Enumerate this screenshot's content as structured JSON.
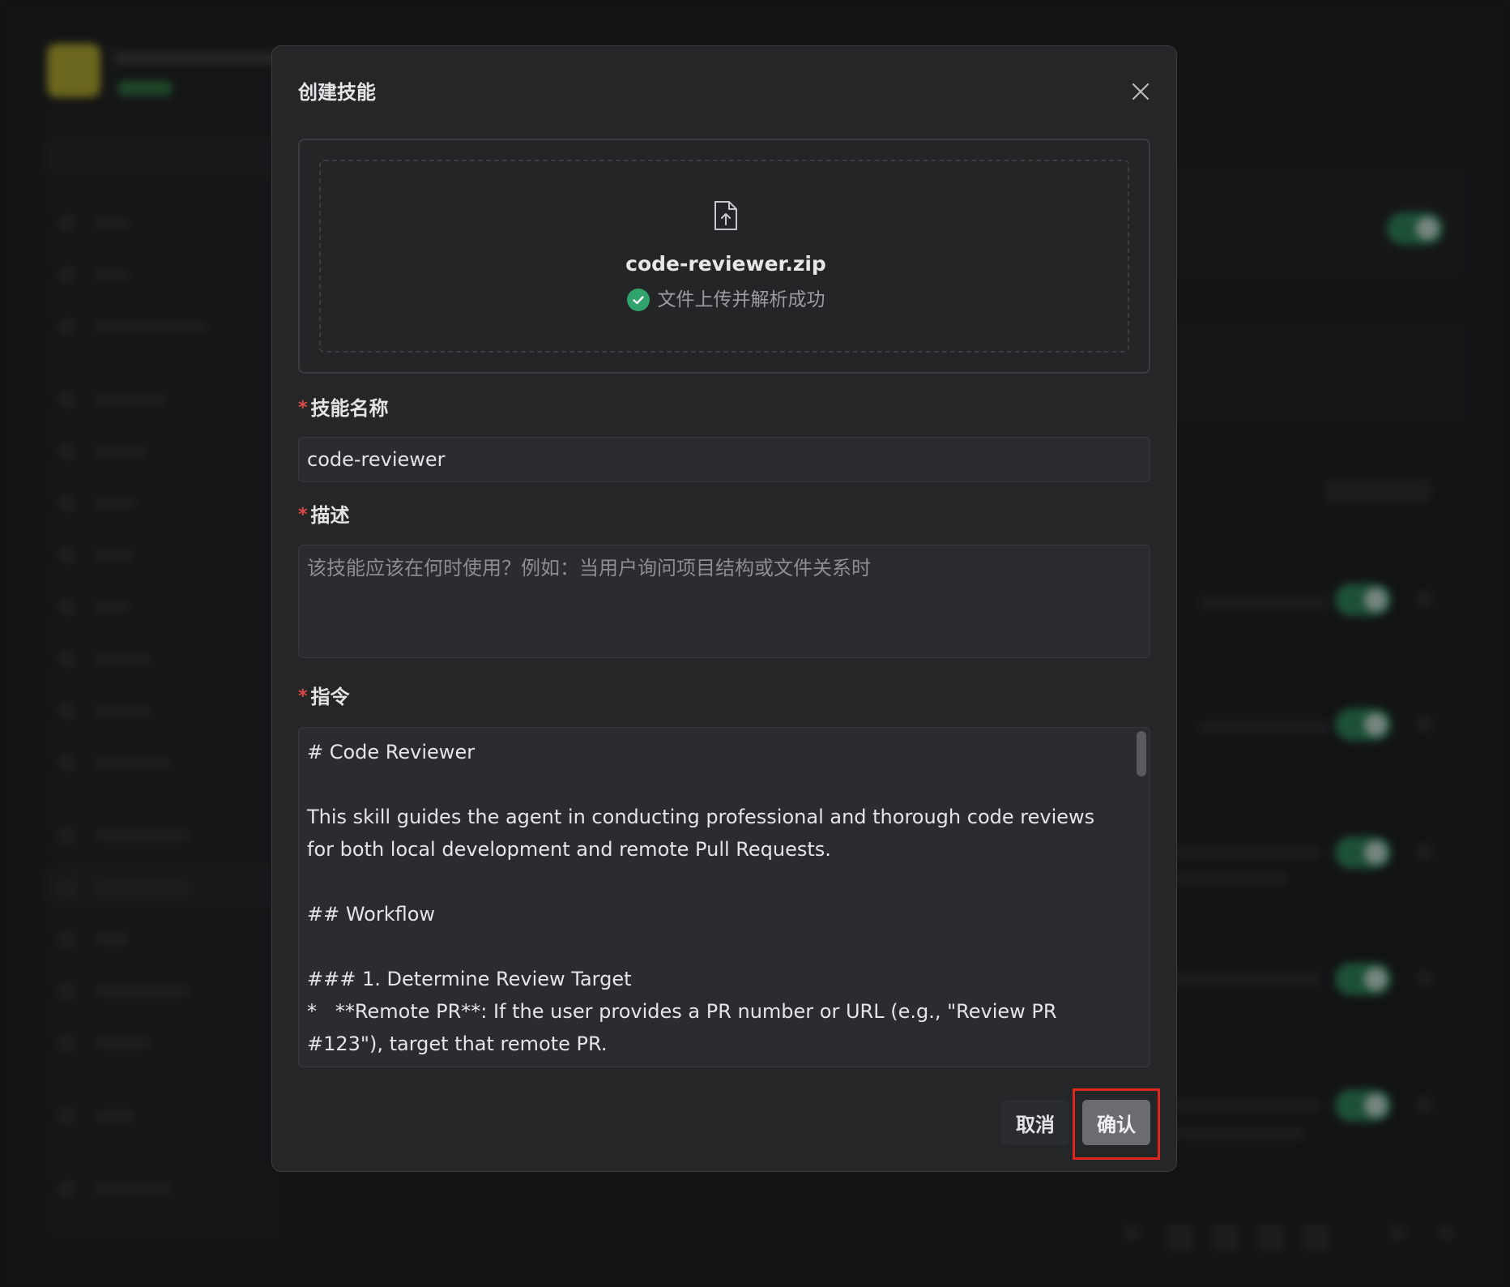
{
  "dialog": {
    "title": "创建技能",
    "upload": {
      "file_name": "code-reviewer.zip",
      "status_text": "文件上传并解析成功"
    },
    "fields": {
      "name_label": "技能名称",
      "name_value": "code-reviewer",
      "description_label": "描述",
      "description_placeholder": "该技能应该在何时使用？例如：当用户询问项目结构或文件关系时",
      "instruction_label": "指令",
      "instruction_value": "# Code Reviewer\n\nThis skill guides the agent in conducting professional and thorough code reviews for both local development and remote Pull Requests.\n\n## Workflow\n\n### 1. Determine Review Target\n*   **Remote PR**: If the user provides a PR number or URL (e.g., \"Review PR #123\"), target that remote PR."
    },
    "buttons": {
      "cancel": "取消",
      "confirm": "确认"
    },
    "required_marker": "*"
  },
  "colors": {
    "dialog_bg": "#252628",
    "required": "#e04a4a",
    "success": "#2fa36b",
    "highlight": "#e0271f"
  },
  "icons": {
    "close": "close-icon",
    "file_upload": "file-upload-icon",
    "success": "check-circle-icon"
  }
}
